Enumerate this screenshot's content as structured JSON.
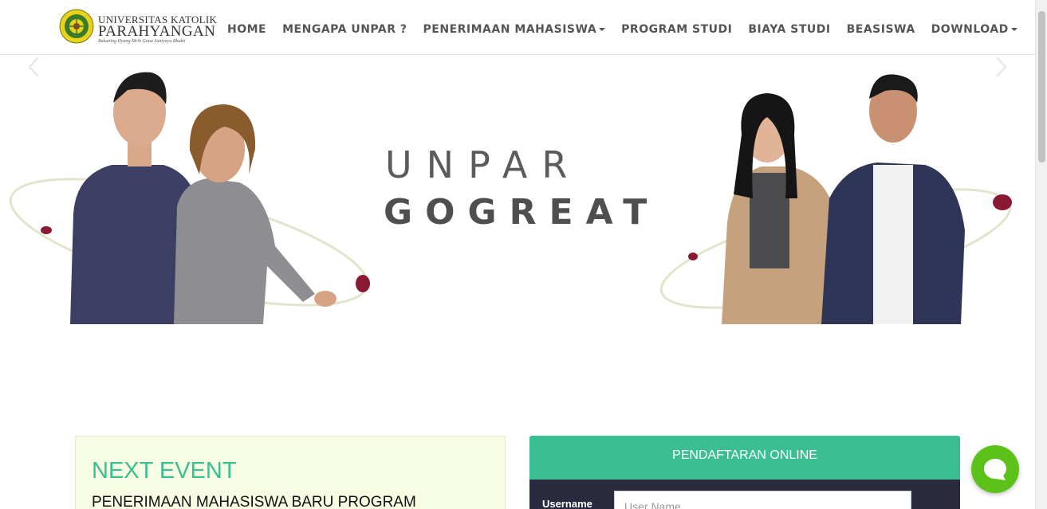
{
  "brand": {
    "line1": "UNIVERSITAS KATOLIK",
    "line2": "PARAHYANGAN",
    "line3": "Bakuning Hyang Mrih Guna Santyaya Bhakti",
    "logo_icon": "university-seal-icon"
  },
  "nav": {
    "items": [
      {
        "label": "HOME",
        "dropdown": false
      },
      {
        "label": "MENGAPA UNPAR ?",
        "dropdown": false
      },
      {
        "label": "PENERIMAAN MAHASISWA",
        "dropdown": true
      },
      {
        "label": "PROGRAM STUDI",
        "dropdown": false
      },
      {
        "label": "BIAYA STUDI",
        "dropdown": false
      },
      {
        "label": "BEASISWA",
        "dropdown": false
      },
      {
        "label": "DOWNLOAD",
        "dropdown": true
      }
    ]
  },
  "hero": {
    "tagline_top": "UNPAR",
    "tagline_bottom": "GOGREAT",
    "prev_icon": "chevron-left-icon",
    "next_icon": "chevron-right-icon"
  },
  "event": {
    "title": "NEXT EVENT",
    "subtitle": "PENERIMAAN MAHASISWA BARU PROGRAM"
  },
  "registration": {
    "header": "PENDAFTARAN ONLINE",
    "username_label": "Username",
    "username_placeholder": "User Name"
  },
  "chat": {
    "icon": "chat-bubble-icon"
  },
  "colors": {
    "accent": "#3bbf92",
    "event_bg": "#f7fde2",
    "form_bg": "#2a2a3f",
    "chat": "#5cc21a",
    "orbit_dot": "#8a1a33"
  }
}
